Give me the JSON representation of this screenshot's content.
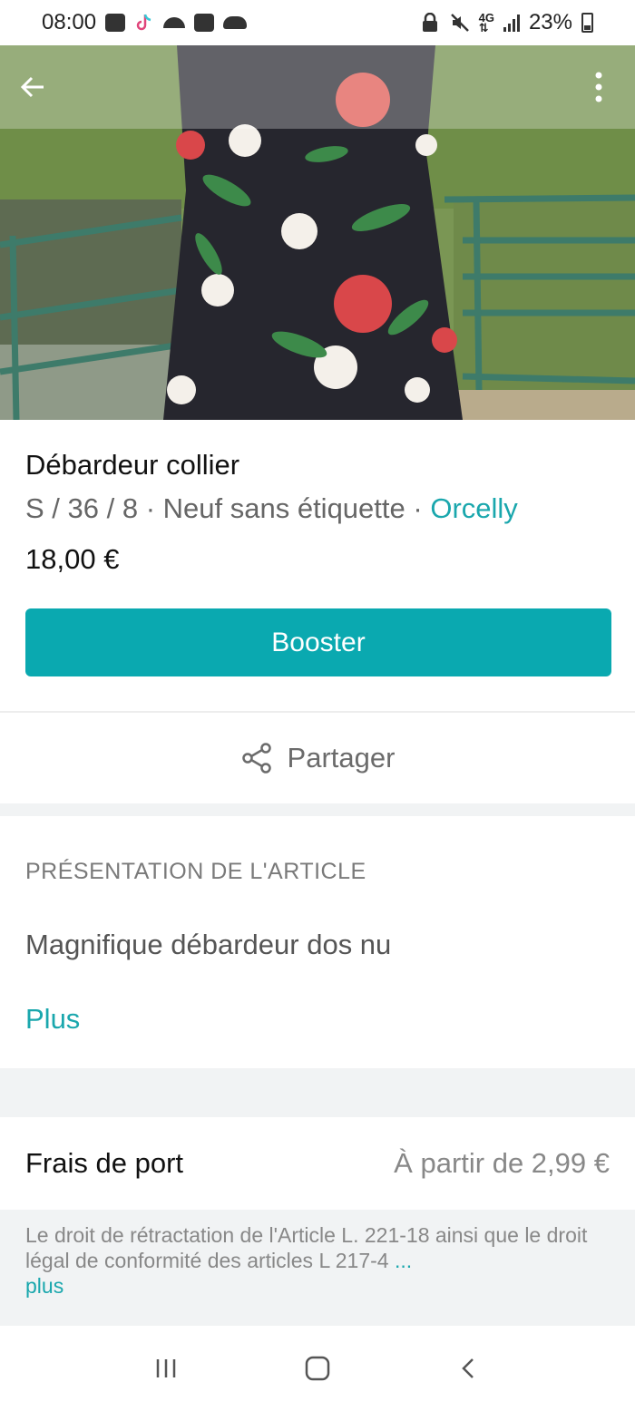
{
  "status_bar": {
    "time": "08:00",
    "battery": "23%",
    "left_icons": [
      "message-icon",
      "tiktok-icon",
      "weather-icon",
      "calendar-icon",
      "cloud-icon"
    ],
    "right_icons": [
      "lock-icon",
      "mute-icon",
      "4g-icon",
      "signal-icon",
      "battery-icon"
    ]
  },
  "header": {
    "back_icon": "arrow-left-icon",
    "menu_icon": "more-vertical-icon"
  },
  "product": {
    "title": "Débardeur collier",
    "size": "S / 36 / 8",
    "separator": " · ",
    "condition": "Neuf sans étiquette",
    "brand": "Orcelly",
    "price": "18,00 €"
  },
  "actions": {
    "booster_label": "Booster",
    "share_label": "Partager",
    "share_icon": "share-icon"
  },
  "presentation": {
    "heading": "PRÉSENTATION DE L'ARTICLE",
    "description": "Magnifique débardeur dos nu",
    "more_label": "Plus"
  },
  "shipping": {
    "label": "Frais de port",
    "value": "À partir de 2,99 €"
  },
  "legal": {
    "text": "Le droit de rétractation de l'Article L. 221-18 ainsi que le droit légal de conformité des articles L 217-4",
    "ellipsis": " ...",
    "more_label": "plus"
  },
  "navbar": {
    "icons": [
      "recent-apps-icon",
      "home-icon",
      "back-icon"
    ]
  },
  "colors": {
    "accent": "#0aa9b0",
    "link": "#1aa7ad",
    "band": "#f1f3f4"
  }
}
